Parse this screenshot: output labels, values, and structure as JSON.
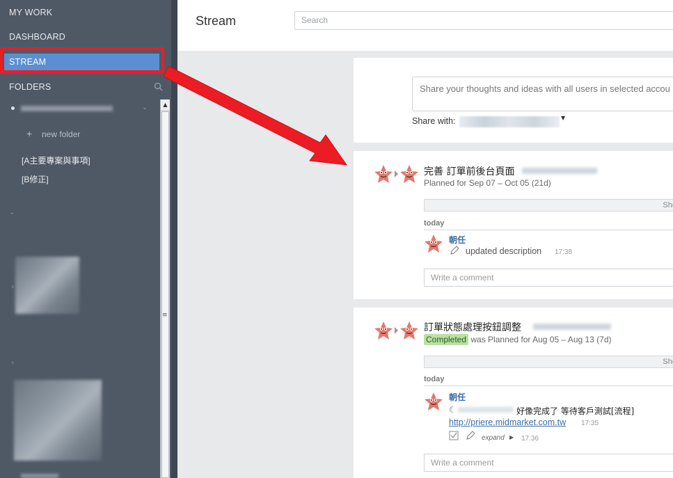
{
  "sidebar": {
    "my_work": "MY WORK",
    "dashboard": "DASHBOARD",
    "stream": "STREAM",
    "folders": "FOLDERS",
    "folder_items": {
      "new_folder": "new folder",
      "folder_a": "[A主要專案與事項]",
      "folder_b": "[B修正]"
    }
  },
  "header": {
    "title": "Stream",
    "search_placeholder": "Search"
  },
  "share": {
    "placeholder": "Share your thoughts and ideas with all users in selected accou",
    "share_with_label": "Share with:"
  },
  "tasks": [
    {
      "title": "完善 訂單前後台頁面",
      "subtitle": "Planned for Sep 07 – Oct 05 (21d)",
      "show_label": "Sho",
      "day": "today",
      "author": "朝任",
      "activity": "updated description",
      "time": "17:38",
      "comment_placeholder": "Write a comment"
    },
    {
      "title": "訂單狀態處理按鈕調整",
      "status_badge": "Completed",
      "subtitle": "was Planned for Aug 05 – Aug 13 (7d)",
      "show_label": "Sho",
      "day": "today",
      "author": "朝任",
      "comment_text": "好像完成了 等待客戶測試[流程]",
      "link": "http://priere.midmarket.com.tw",
      "link_time": "17:35",
      "expand_label": "expand",
      "expand_time": "17:36",
      "comment_placeholder": "Write a comment"
    }
  ],
  "colors": {
    "sidebar_bg": "#4f5966",
    "active_nav": "#5b8fd1",
    "annotation_red": "#ec1c24",
    "link_blue": "#3b6ea5",
    "completed_green": "#b9e0a5"
  }
}
